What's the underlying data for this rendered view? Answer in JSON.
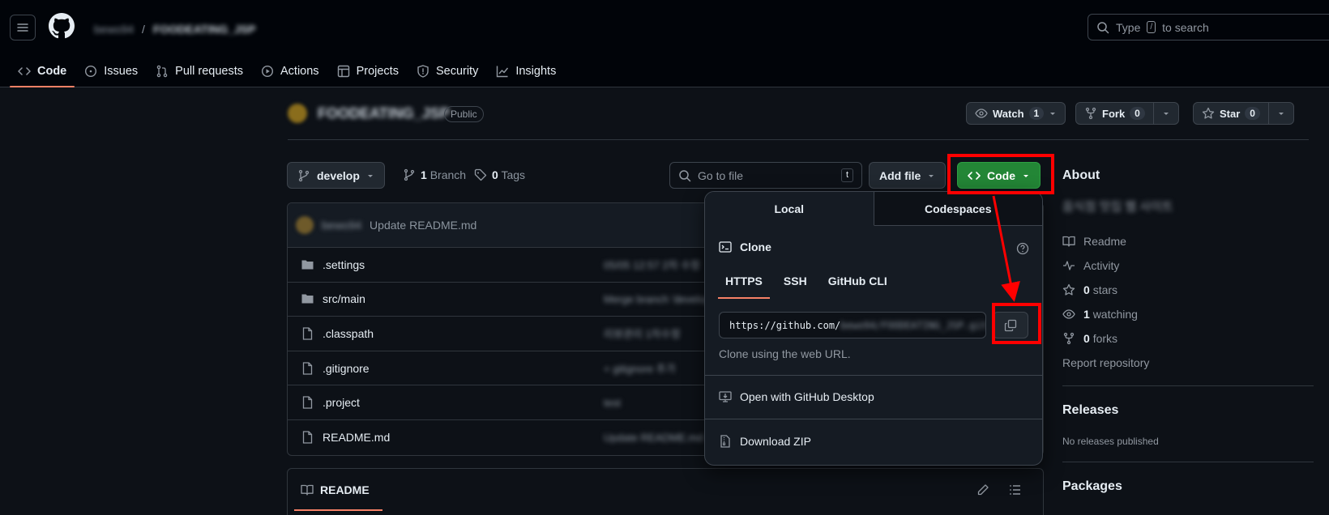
{
  "header": {
    "owner": "bewo94",
    "repo": "FOODEATING_JSP",
    "search_prefix": "Type",
    "search_key": "/",
    "search_suffix": "to search"
  },
  "nav": {
    "tabs": [
      {
        "label": "Code",
        "icon": "code-icon"
      },
      {
        "label": "Issues",
        "icon": "issue-icon"
      },
      {
        "label": "Pull requests",
        "icon": "pull-request-icon"
      },
      {
        "label": "Actions",
        "icon": "play-icon"
      },
      {
        "label": "Projects",
        "icon": "table-icon"
      },
      {
        "label": "Security",
        "icon": "shield-icon"
      },
      {
        "label": "Insights",
        "icon": "graph-icon"
      }
    ]
  },
  "repo": {
    "name": "FOODEATING_JSP",
    "visibility": "Public",
    "watch_label": "Watch",
    "watch_count": "1",
    "fork_label": "Fork",
    "fork_count": "0",
    "star_label": "Star",
    "star_count": "0"
  },
  "toolbar": {
    "branch": "develop",
    "branch_count": "1",
    "branch_label": "Branch",
    "tag_count": "0",
    "tag_label": "Tags",
    "goto_placeholder": "Go to file",
    "goto_key": "t",
    "add_file": "Add file",
    "code": "Code"
  },
  "commit": {
    "author": "bewo94",
    "message": "Update README.md"
  },
  "files": [
    {
      "name": ".settings",
      "type": "folder",
      "msg": "05/05 12:57 2차 수정"
    },
    {
      "name": "src/main",
      "type": "folder",
      "msg": "Merge branch 'develop'"
    },
    {
      "name": ".classpath",
      "type": "file",
      "msg": "리뷰관리 1차수정"
    },
    {
      "name": ".gitignore",
      "type": "file",
      "msg": "+ gitignore 추가"
    },
    {
      "name": ".project",
      "type": "file",
      "msg": "test"
    },
    {
      "name": "README.md",
      "type": "file",
      "msg": "Update README.md"
    }
  ],
  "readme": {
    "label": "README"
  },
  "dropdown": {
    "tab_local": "Local",
    "tab_codespaces": "Codespaces",
    "clone_title": "Clone",
    "protocols": [
      "HTTPS",
      "SSH",
      "GitHub CLI"
    ],
    "url_visible": "https://github.com/",
    "url_hidden": "bewo94/FOODEATING_JSP.git",
    "hint": "Clone using the web URL.",
    "open_desktop": "Open with GitHub Desktop",
    "download_zip": "Download ZIP"
  },
  "sidebar": {
    "about": "About",
    "description": "음식점 맛집 웹 사이트",
    "readme": "Readme",
    "activity": "Activity",
    "stars_count": "0",
    "stars_label": "stars",
    "watching_count": "1",
    "watching_label": "watching",
    "forks_count": "0",
    "forks_label": "forks",
    "report": "Report repository",
    "releases": "Releases",
    "no_releases": "No releases published",
    "packages": "Packages"
  },
  "colors": {
    "accent": "#f78166",
    "code_button": "#238636",
    "highlight": "#ff0000"
  }
}
